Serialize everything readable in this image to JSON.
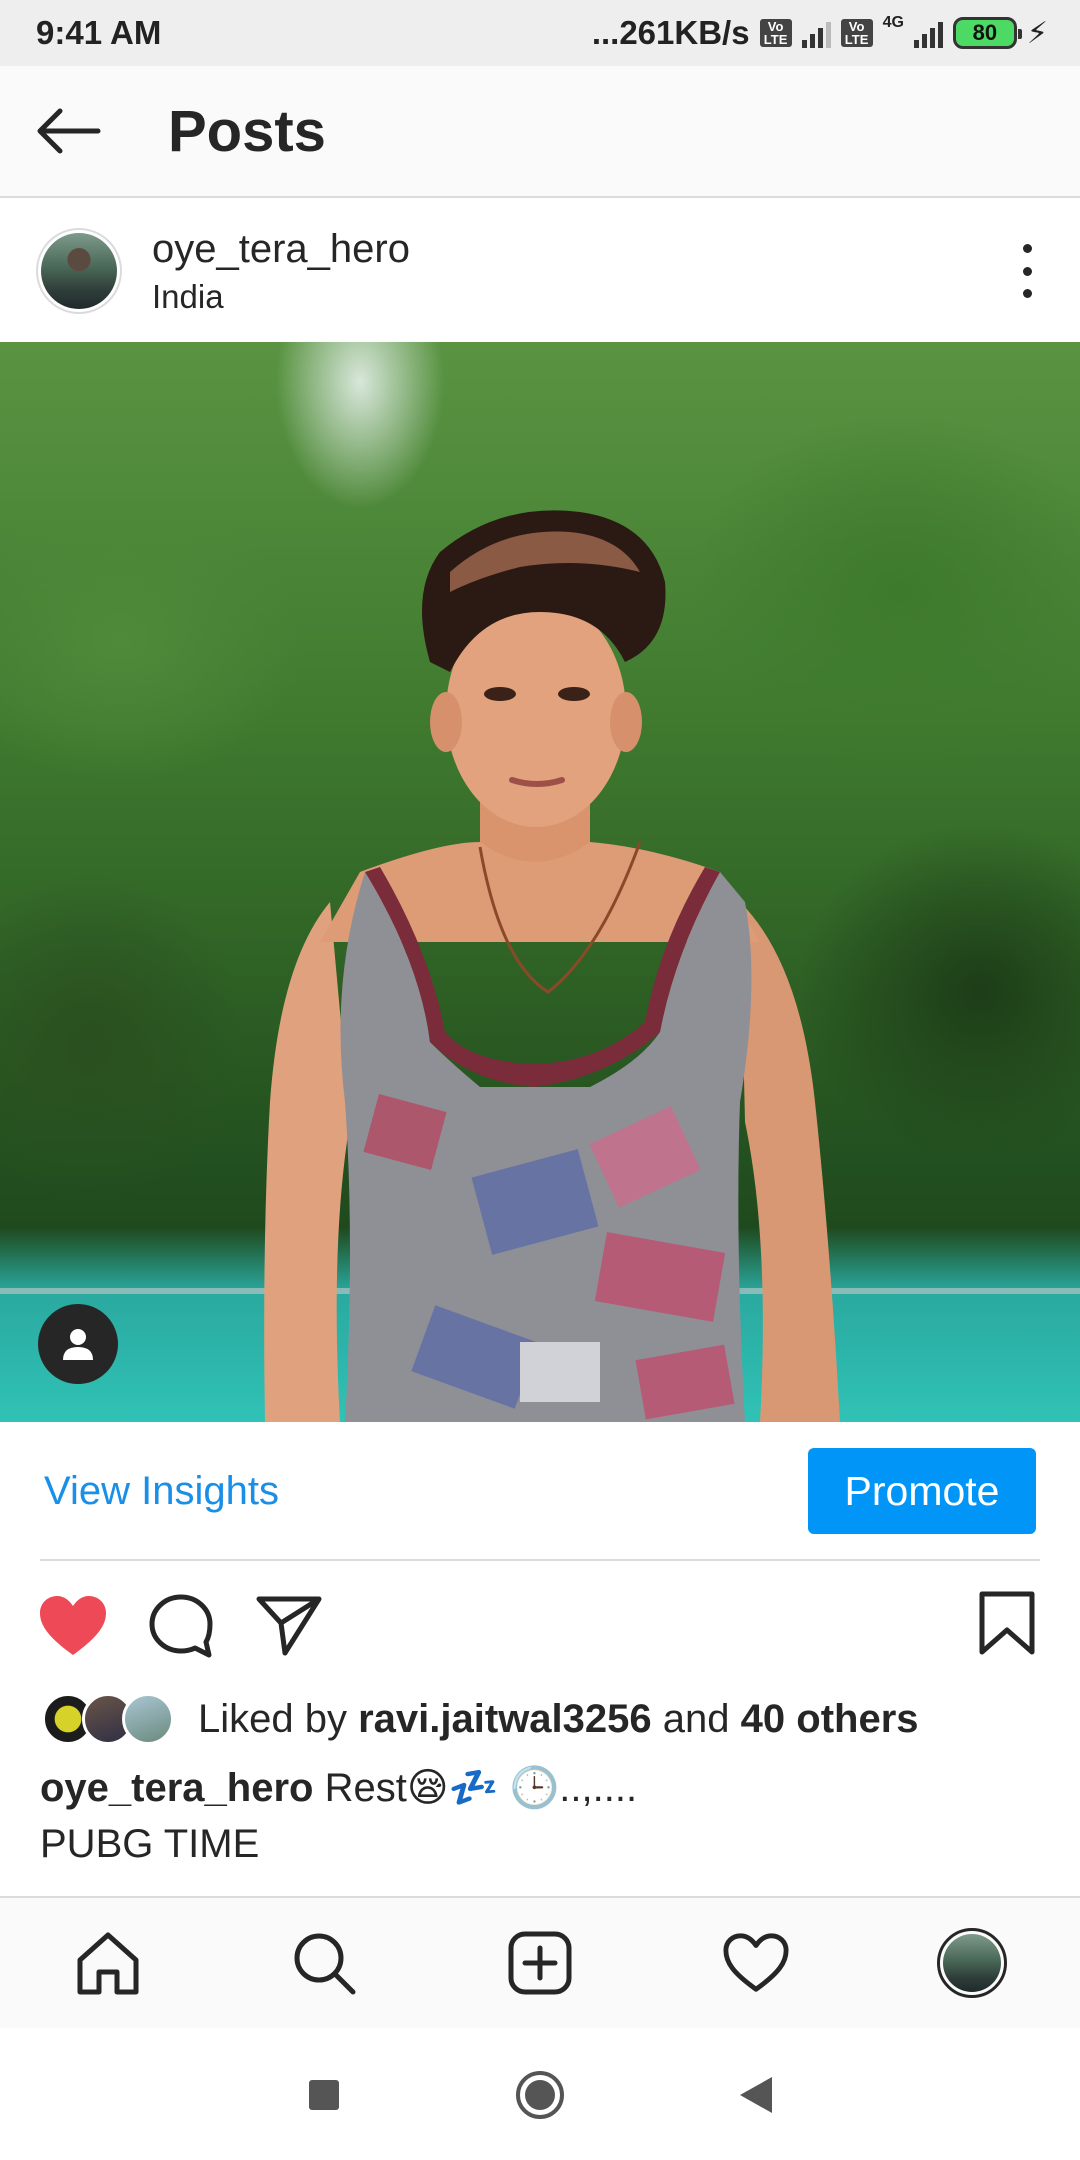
{
  "status_bar": {
    "time": "9:41 AM",
    "network_speed": "...261KB/s",
    "volte_label": "Vo LTE",
    "network_type": "4G",
    "battery_percent": "80"
  },
  "header": {
    "title": "Posts"
  },
  "post": {
    "username": "oye_tera_hero",
    "location": "India",
    "view_insights_label": "View Insights",
    "promote_label": "Promote",
    "likes": {
      "prefix": "Liked by",
      "liked_by_user": "ravi.jaitwal3256",
      "connector": "and",
      "others": "40 others"
    },
    "caption": {
      "username": "oye_tera_hero",
      "text": "Rest😪💤 🕒..,....",
      "line2": "PUBG TIME"
    }
  },
  "bottom_nav": {
    "items": [
      "home-icon",
      "search-icon",
      "add-post-icon",
      "activity-heart-icon",
      "profile-avatar"
    ]
  },
  "colors": {
    "accent_blue": "#0095f6",
    "link_blue": "#1a8fe8",
    "like_red": "#ed4956",
    "text": "#262626"
  }
}
